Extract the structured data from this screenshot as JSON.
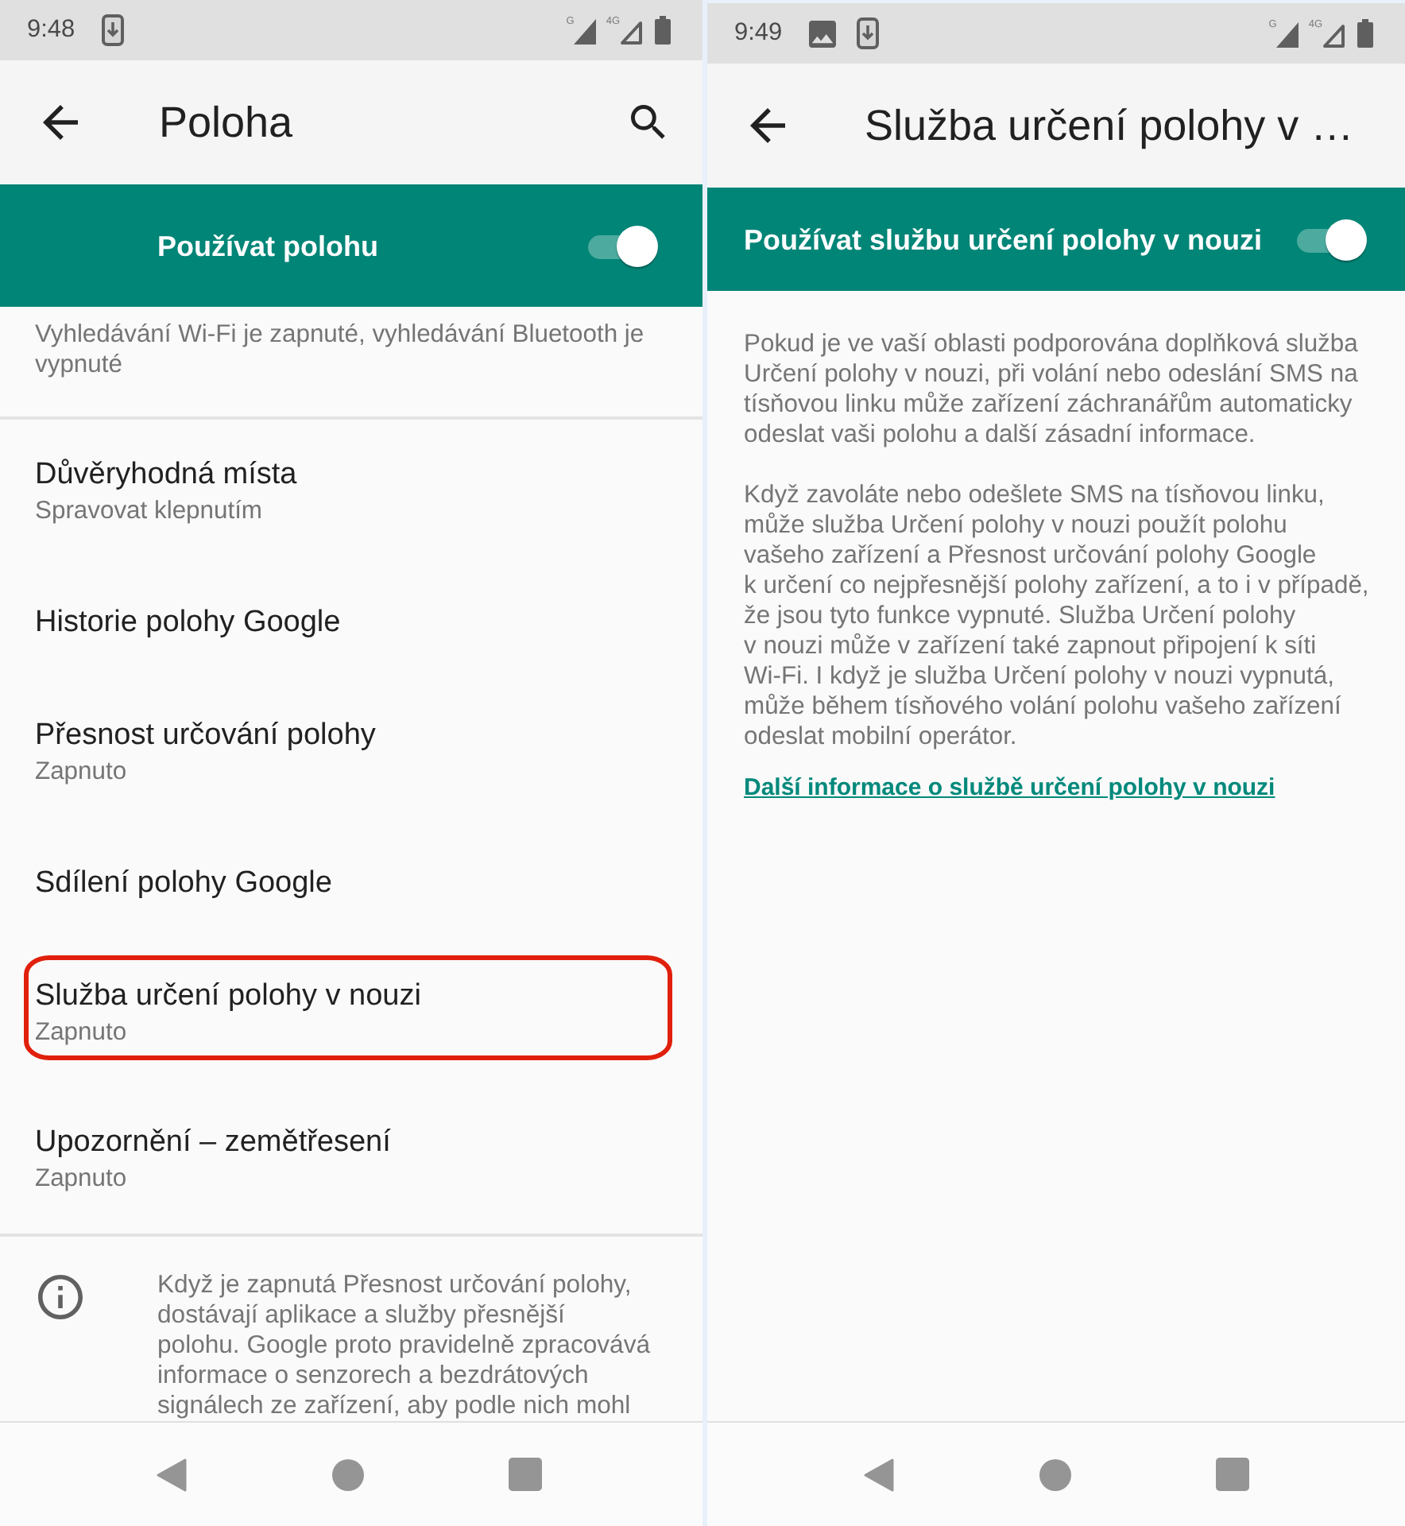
{
  "location_screen": {
    "status_bar": {
      "time": "9:48",
      "notifications": [
        {
          "kind": "download"
        }
      ],
      "signals": [
        {
          "label": "G",
          "full": true
        },
        {
          "label": "4G",
          "full": false
        }
      ]
    },
    "app_bar": {
      "title": "Poloha",
      "search": true
    },
    "switch_bar": {
      "label": "Používat polohu",
      "on": true
    },
    "scan_summary": "Vyhledávání Wi-Fi je zapnuté, vyhledávání Bluetooth je vypnuté",
    "items": [
      {
        "title": "Důvěryhodná místa",
        "summary": "Spravovat klepnutím",
        "highlighted": false
      },
      {
        "title": "Historie polohy Google",
        "highlighted": false
      },
      {
        "title": "Přesnost určování polohy",
        "summary": "Zapnuto",
        "highlighted": false
      },
      {
        "title": "Sdílení polohy Google",
        "highlighted": false
      },
      {
        "title": "Služba určení polohy v nouzi",
        "summary": "Zapnuto",
        "highlighted": true
      },
      {
        "title": "Upozornění – zemětřesení",
        "summary": "Zapnuto",
        "highlighted": false
      }
    ],
    "info_note": "Když je zapnutá Přesnost určování polohy, dostávají aplikace a služby přesnější polohu. Google proto pravidelně zpracovává informace o senzorech a bezdrátových signálech ze zařízení, aby podle nich mohl"
  },
  "emergency_screen": {
    "status_bar": {
      "time": "9:49",
      "notifications": [
        {
          "kind": "image"
        },
        {
          "kind": "download"
        }
      ],
      "signals": [
        {
          "label": "G",
          "full": true
        },
        {
          "label": "4G",
          "full": false
        }
      ]
    },
    "app_bar": {
      "title": "Služba určení polohy v …"
    },
    "switch_bar": {
      "label": "Používat službu určení polohy v nouzi",
      "on": true
    },
    "paragraphs": [
      "Pokud je ve vaší oblasti podporována doplňková služba Určení polohy v nouzi, při volání nebo odeslání SMS na tísňovou linku může zařízení záchranářům automaticky odeslat vaši polohu a další zásadní informace.",
      "Když zavoláte nebo odešlete SMS na tísňovou linku, může služba Určení polohy v nouzi použít polohu vašeho zařízení a Přesnost určování polohy Google k určení co nejpřesnější polohy zařízení, a to i v případě, že jsou tyto funkce vypnuté. Služba Určení polohy v nouzi může v zařízení také zapnout připojení k síti Wi-Fi. I když je služba Určení polohy v nouzi vypnutá, může během tísňového volání polohu vašeho zařízení odeslat mobilní operátor."
    ],
    "link": "Další informace o službě určení polohy v nouzi"
  }
}
